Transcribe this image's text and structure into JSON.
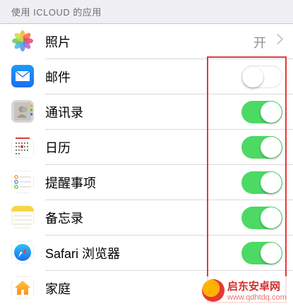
{
  "section": {
    "header": "使用 ICLOUD 的应用"
  },
  "rows": [
    {
      "label": "照片",
      "icon": "photos-icon",
      "type": "value",
      "value": "开"
    },
    {
      "label": "邮件",
      "icon": "mail-icon",
      "type": "toggle",
      "on": false
    },
    {
      "label": "通讯录",
      "icon": "contacts-icon",
      "type": "toggle",
      "on": true
    },
    {
      "label": "日历",
      "icon": "calendar-icon",
      "type": "toggle",
      "on": true
    },
    {
      "label": "提醒事项",
      "icon": "reminders-icon",
      "type": "toggle",
      "on": true
    },
    {
      "label": "备忘录",
      "icon": "notes-icon",
      "type": "toggle",
      "on": true
    },
    {
      "label": "Safari 浏览器",
      "icon": "safari-icon",
      "type": "toggle",
      "on": true
    },
    {
      "label": "家庭",
      "icon": "home-icon",
      "type": "none"
    }
  ],
  "colors": {
    "toggle_on": "#4cd964",
    "highlight": "#e53935"
  },
  "watermark": {
    "title": "启东安卓网",
    "url": "www.qdhtdq.com"
  }
}
